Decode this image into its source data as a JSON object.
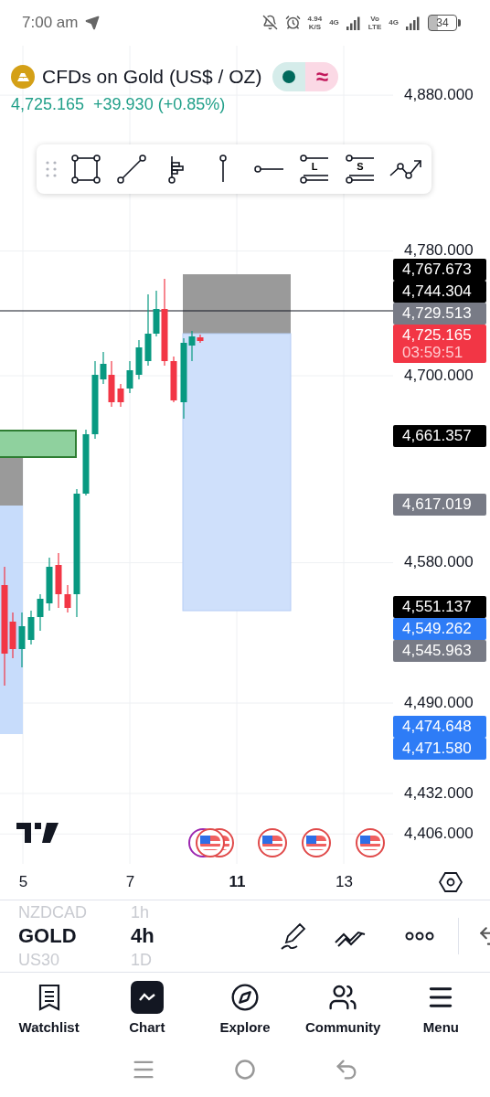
{
  "status_bar": {
    "time": "7:00 am",
    "speed": "4.94",
    "speed_unit": "K/S",
    "network_1": "4G",
    "volte_top": "Vo",
    "volte_bottom": "LTE",
    "network_2": "4G",
    "battery": "34"
  },
  "header": {
    "title": "CFDs on Gold (US$ / OZ)",
    "status_symbol": "≈",
    "price": "4,725.165",
    "change": "+39.930 (+0.85%)"
  },
  "drawing_toolbar": [
    {
      "kind": "rectangle"
    },
    {
      "kind": "trend-line"
    },
    {
      "kind": "fib"
    },
    {
      "kind": "vertical-line"
    },
    {
      "kind": "horizontal-ray"
    },
    {
      "kind": "long",
      "label": "L"
    },
    {
      "kind": "short",
      "label": "S"
    },
    {
      "kind": "path"
    }
  ],
  "price_axis": {
    "ticks": [
      "4,880.000",
      "4,780.000",
      "4,700.000",
      "4,580.000",
      "4,490.000",
      "4,432.000",
      "4,406.000"
    ],
    "markers": [
      {
        "price": "4,767.673",
        "color": "#000000"
      },
      {
        "price": "4,744.304",
        "color": "#000000"
      },
      {
        "price": "4,729.513",
        "color": "#787b86"
      },
      {
        "price": "4,725.165",
        "countdown": "03:59:51",
        "color": "#f23645"
      },
      {
        "price": "4,661.357",
        "color": "#000000"
      },
      {
        "price": "4,617.019",
        "color": "#787b86"
      },
      {
        "price": "4,551.137",
        "color": "#000000"
      },
      {
        "price": "4,549.262",
        "color": "#2e7cf6"
      },
      {
        "price": "4,545.963",
        "color": "#787b86"
      },
      {
        "price": "4,474.648",
        "color": "#2e7cf6"
      },
      {
        "price": "4,471.580",
        "color": "#2e7cf6"
      }
    ]
  },
  "time_axis": [
    {
      "label": "5",
      "emphasized": false
    },
    {
      "label": "7",
      "emphasized": false
    },
    {
      "label": "11",
      "emphasized": true
    },
    {
      "label": "13",
      "emphasized": false
    }
  ],
  "symbol_bar": {
    "symbols": [
      {
        "label": "NZDCAD",
        "selected": false
      },
      {
        "label": "GOLD",
        "selected": true
      },
      {
        "label": "US30",
        "selected": false
      }
    ],
    "intervals": [
      {
        "label": "1h",
        "selected": false
      },
      {
        "label": "4h",
        "selected": true
      },
      {
        "label": "1D",
        "selected": false
      }
    ]
  },
  "bottom_nav": [
    {
      "kind": "watchlist",
      "label": "Watchlist",
      "selected": false
    },
    {
      "kind": "chart",
      "label": "Chart",
      "selected": true
    },
    {
      "kind": "explore",
      "label": "Explore",
      "selected": false
    },
    {
      "kind": "community",
      "label": "Community",
      "selected": false
    },
    {
      "kind": "menu",
      "label": "Menu",
      "selected": false
    }
  ]
}
